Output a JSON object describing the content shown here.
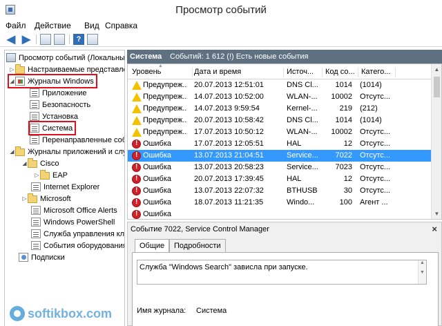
{
  "window": {
    "title": "Просмотр событий"
  },
  "menu": {
    "file": "Файл",
    "action": "Действие",
    "view": "Вид",
    "help": "Справка"
  },
  "toolbar": {
    "back": "back-arrow-icon",
    "forward": "forward-arrow-icon",
    "up": "up-folder-icon",
    "show_hide": "show-hide-tree-icon",
    "help": "help-icon",
    "properties": "properties-icon"
  },
  "tree": {
    "root": "Просмотр событий (Локальный)",
    "items": [
      {
        "label": "Настраиваемые представления",
        "kind": "folder",
        "expander": "▷"
      },
      {
        "label": "Журналы Windows",
        "kind": "win",
        "expander": "◢",
        "highlighted": true
      },
      {
        "label": "Приложение",
        "kind": "log"
      },
      {
        "label": "Безопасность",
        "kind": "log"
      },
      {
        "label": "Установка",
        "kind": "log"
      },
      {
        "label": "Система",
        "kind": "log",
        "highlighted": true
      },
      {
        "label": "Перенаправленные события",
        "kind": "log"
      },
      {
        "label": "Журналы приложений и служб",
        "kind": "folder",
        "expander": "◢"
      },
      {
        "label": "Cisco",
        "kind": "folder",
        "expander": "◢"
      },
      {
        "label": "EAP",
        "kind": "folder",
        "expander": "▷"
      },
      {
        "label": "Internet Explorer",
        "kind": "log"
      },
      {
        "label": "Microsoft",
        "kind": "folder",
        "expander": "▷"
      },
      {
        "label": "Microsoft Office Alerts",
        "kind": "log"
      },
      {
        "label": "Windows PowerShell",
        "kind": "log"
      },
      {
        "label": "Служба управления ключами",
        "kind": "log"
      },
      {
        "label": "События оборудования",
        "kind": "log"
      },
      {
        "label": "Подписки",
        "kind": "sub"
      }
    ]
  },
  "events_panel": {
    "title": "Система",
    "count_text": "Событий: 1 612 (!) Есть новые события"
  },
  "columns": {
    "level": "Уровень",
    "datetime": "Дата и время",
    "source": "Источ...",
    "event_id": "Код со...",
    "category": "Катего..."
  },
  "events": [
    {
      "severity": "warning",
      "level": "Предупреж...",
      "datetime": "20.07.2013 12:51:01",
      "source": "DNS Cl...",
      "id": "1014",
      "category": "(1014)"
    },
    {
      "severity": "warning",
      "level": "Предупреж...",
      "datetime": "14.07.2013 10:52:00",
      "source": "WLAN-...",
      "id": "10002",
      "category": "Отсутс..."
    },
    {
      "severity": "warning",
      "level": "Предупреж...",
      "datetime": "14.07.2013 9:59:54",
      "source": "Kernel-...",
      "id": "219",
      "category": "(212)"
    },
    {
      "severity": "warning",
      "level": "Предупреж...",
      "datetime": "20.07.2013 10:58:42",
      "source": "DNS Cl...",
      "id": "1014",
      "category": "(1014)"
    },
    {
      "severity": "warning",
      "level": "Предупреж...",
      "datetime": "17.07.2013 10:50:12",
      "source": "WLAN-...",
      "id": "10002",
      "category": "Отсутс..."
    },
    {
      "severity": "error",
      "level": "Ошибка",
      "datetime": "17.07.2013 12:05:51",
      "source": "HAL",
      "id": "12",
      "category": "Отсутс..."
    },
    {
      "severity": "error",
      "level": "Ошибка",
      "datetime": "13.07.2013 21:04:51",
      "source": "Service...",
      "id": "7022",
      "category": "Отсутс...",
      "selected": true
    },
    {
      "severity": "error",
      "level": "Ошибка",
      "datetime": "13.07.2013 20:58:23",
      "source": "Service...",
      "id": "7023",
      "category": "Отсутс..."
    },
    {
      "severity": "error",
      "level": "Ошибка",
      "datetime": "20.07.2013 17:39:45",
      "source": "HAL",
      "id": "12",
      "category": "Отсутс..."
    },
    {
      "severity": "error",
      "level": "Ошибка",
      "datetime": "13.07.2013 22:07:32",
      "source": "BTHUSB",
      "id": "30",
      "category": "Отсутс..."
    },
    {
      "severity": "error",
      "level": "Ошибка",
      "datetime": "18.07.2013 11:21:35",
      "source": "Windo...",
      "id": "100",
      "category": "Агент ..."
    },
    {
      "severity": "error",
      "level": "Ошибка",
      "datetime": "",
      "source": "",
      "id": "",
      "category": ""
    }
  ],
  "detail": {
    "title": "Событие 7022, Service Control Manager",
    "close": "×",
    "tabs": [
      "Общие",
      "Подробности"
    ],
    "message": "Служба \"Windows Search\" зависла при запуске.",
    "log_name_label": "Имя журнала:",
    "log_name_value": "Система"
  },
  "watermark": {
    "text": "softikbox.com"
  }
}
